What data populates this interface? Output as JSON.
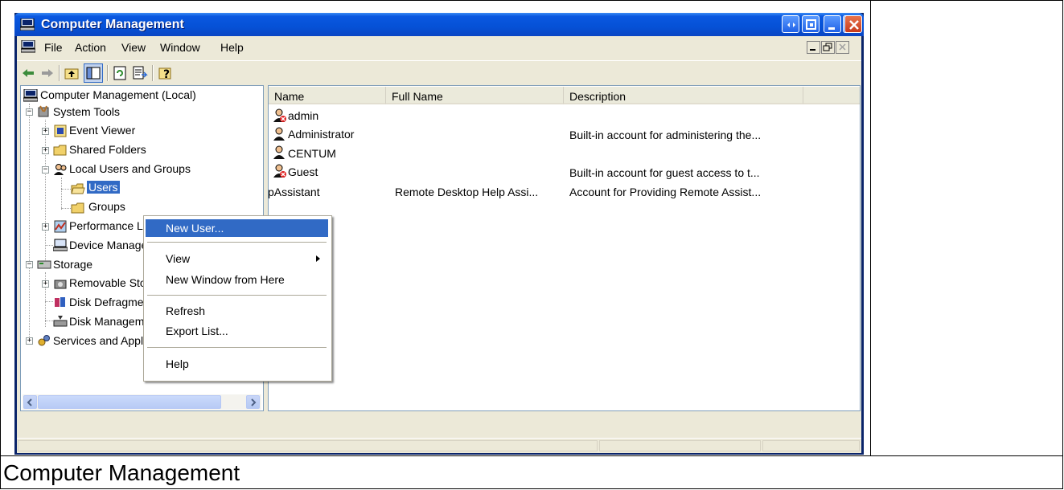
{
  "window": {
    "title": "Computer Management",
    "caption_below": "Computer Management"
  },
  "menu": {
    "file": "File",
    "action": "Action",
    "view": "View",
    "window": "Window",
    "help": "Help"
  },
  "tree": {
    "root": "Computer Management (Local)",
    "system_tools": "System Tools",
    "event_viewer": "Event Viewer",
    "shared_folders": "Shared Folders",
    "local_users_groups": "Local Users and Groups",
    "users": "Users",
    "groups": "Groups",
    "performance": "Performance Logs and Alerts",
    "device_manager": "Device Manager",
    "storage": "Storage",
    "removable": "Removable Storage",
    "disk_defrag": "Disk Defragmenter",
    "disk_mgmt": "Disk Management",
    "services": "Services and Applications"
  },
  "list": {
    "columns": [
      "Name",
      "Full Name",
      "Description"
    ],
    "rows": [
      {
        "name": "admin",
        "full_name": "",
        "description": ""
      },
      {
        "name": "Administrator",
        "full_name": "",
        "description": "Built-in account for administering the..."
      },
      {
        "name": "CENTUM",
        "full_name": "",
        "description": ""
      },
      {
        "name": "Guest",
        "full_name": "",
        "description": "Built-in account for guest access to t..."
      },
      {
        "name": "HelpAssistant",
        "full_name": "Remote Desktop Help Assi...",
        "description": "Account for Providing Remote Assist..."
      }
    ]
  },
  "context_menu": {
    "new_user": "New User...",
    "view": "View",
    "new_window": "New Window from Here",
    "refresh": "Refresh",
    "export_list": "Export List...",
    "help": "Help"
  },
  "colors": {
    "title_blue": "#0551D6",
    "selection": "#316AC5",
    "chrome": "#ECE9D8"
  }
}
